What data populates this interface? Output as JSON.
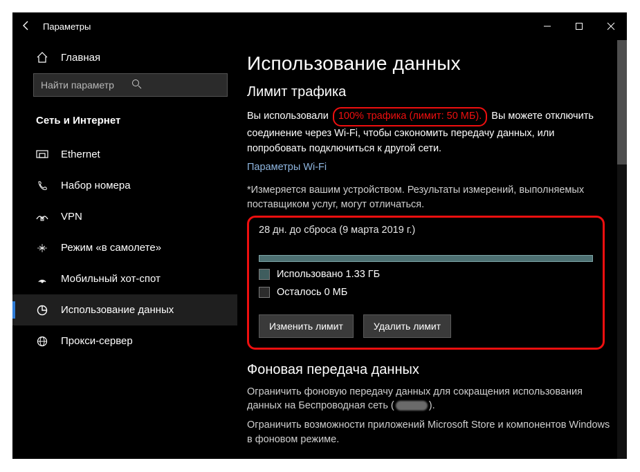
{
  "window": {
    "title": "Параметры"
  },
  "sidebar": {
    "home": "Главная",
    "search_placeholder": "Найти параметр",
    "category": "Сеть и Интернет",
    "items": [
      {
        "label": "Ethernet"
      },
      {
        "label": "Набор номера"
      },
      {
        "label": "VPN"
      },
      {
        "label": "Режим «в самолете»"
      },
      {
        "label": "Мобильный хот-спот"
      },
      {
        "label": "Использование данных",
        "active": true
      },
      {
        "label": "Прокси-сервер"
      }
    ]
  },
  "main": {
    "page_title": "Использование данных",
    "traffic_limit": {
      "title": "Лимит трафика",
      "prefix": "Вы использовали ",
      "highlight": "100% трафика (лимит: 50 МБ).",
      "suffix": " Вы можете отключить соединение через Wi-Fi, чтобы сэкономить передачу данных, или попробовать подключиться к другой сети.",
      "link": "Параметры Wi-Fi",
      "note": "*Измеряется вашим устройством. Результаты измерений, выполняемых поставщиком услуг, могут отличаться.",
      "reset": "28 дн. до сброса (9 марта 2019 г.)",
      "used_label": "Использовано 1.33 ГБ",
      "left_label": "Осталось 0 МБ",
      "btn_change": "Изменить лимит",
      "btn_remove": "Удалить лимит",
      "used_pct": 100
    },
    "background": {
      "title": "Фоновая передача данных",
      "p1a": "Ограничить фоновую передачу данных для сокращения использования данных на Беспроводная сеть (",
      "p1b": ").",
      "p2": "Ограничить возможности приложений Microsoft Store и компонентов Windows в фоновом режиме."
    }
  }
}
